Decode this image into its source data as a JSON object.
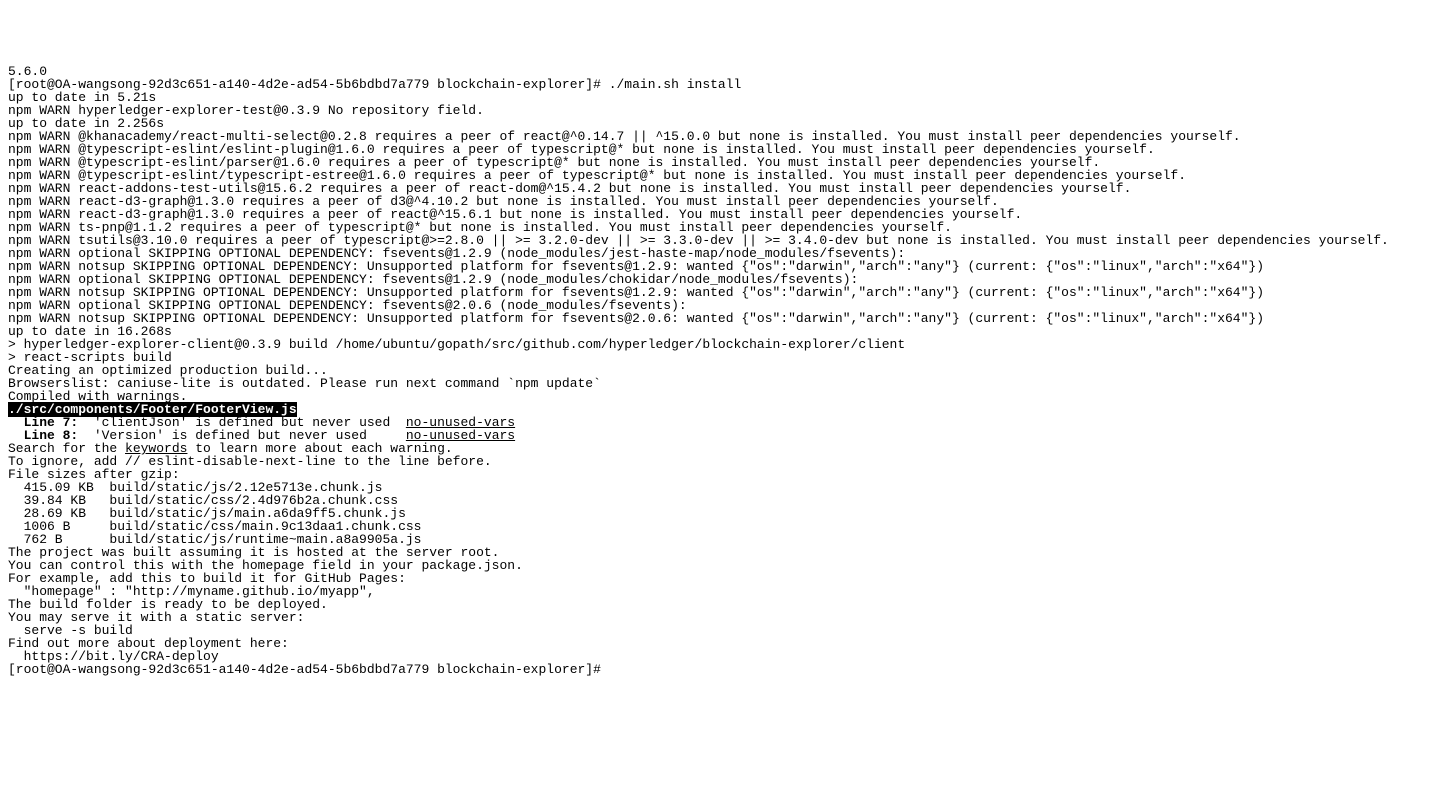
{
  "lines": [
    {
      "text": "5.6.0"
    },
    {
      "text": "[root@OA-wangsong-92d3c651-a140-4d2e-ad54-5b6bdbd7a779 blockchain-explorer]# ./main.sh install"
    },
    {
      "text": "up to date in 5.21s"
    },
    {
      "text": "npm WARN hyperledger-explorer-test@0.3.9 No repository field."
    },
    {
      "text": ""
    },
    {
      "text": "up to date in 2.256s"
    },
    {
      "text": "npm WARN @khanacademy/react-multi-select@0.2.8 requires a peer of react@^0.14.7 || ^15.0.0 but none is installed. You must install peer dependencies yourself."
    },
    {
      "text": "npm WARN @typescript-eslint/eslint-plugin@1.6.0 requires a peer of typescript@* but none is installed. You must install peer dependencies yourself."
    },
    {
      "text": "npm WARN @typescript-eslint/parser@1.6.0 requires a peer of typescript@* but none is installed. You must install peer dependencies yourself."
    },
    {
      "text": "npm WARN @typescript-eslint/typescript-estree@1.6.0 requires a peer of typescript@* but none is installed. You must install peer dependencies yourself."
    },
    {
      "text": "npm WARN react-addons-test-utils@15.6.2 requires a peer of react-dom@^15.4.2 but none is installed. You must install peer dependencies yourself."
    },
    {
      "text": "npm WARN react-d3-graph@1.3.0 requires a peer of d3@^4.10.2 but none is installed. You must install peer dependencies yourself."
    },
    {
      "text": "npm WARN react-d3-graph@1.3.0 requires a peer of react@^15.6.1 but none is installed. You must install peer dependencies yourself."
    },
    {
      "text": "npm WARN ts-pnp@1.1.2 requires a peer of typescript@* but none is installed. You must install peer dependencies yourself."
    },
    {
      "text": "npm WARN tsutils@3.10.0 requires a peer of typescript@>=2.8.0 || >= 3.2.0-dev || >= 3.3.0-dev || >= 3.4.0-dev but none is installed. You must install peer dependencies yourself."
    },
    {
      "text": "npm WARN optional SKIPPING OPTIONAL DEPENDENCY: fsevents@1.2.9 (node_modules/jest-haste-map/node_modules/fsevents):"
    },
    {
      "text": "npm WARN notsup SKIPPING OPTIONAL DEPENDENCY: Unsupported platform for fsevents@1.2.9: wanted {\"os\":\"darwin\",\"arch\":\"any\"} (current: {\"os\":\"linux\",\"arch\":\"x64\"})"
    },
    {
      "text": "npm WARN optional SKIPPING OPTIONAL DEPENDENCY: fsevents@1.2.9 (node_modules/chokidar/node_modules/fsevents):"
    },
    {
      "text": "npm WARN notsup SKIPPING OPTIONAL DEPENDENCY: Unsupported platform for fsevents@1.2.9: wanted {\"os\":\"darwin\",\"arch\":\"any\"} (current: {\"os\":\"linux\",\"arch\":\"x64\"})"
    },
    {
      "text": "npm WARN optional SKIPPING OPTIONAL DEPENDENCY: fsevents@2.0.6 (node_modules/fsevents):"
    },
    {
      "text": "npm WARN notsup SKIPPING OPTIONAL DEPENDENCY: Unsupported platform for fsevents@2.0.6: wanted {\"os\":\"darwin\",\"arch\":\"any\"} (current: {\"os\":\"linux\",\"arch\":\"x64\"})"
    },
    {
      "text": ""
    },
    {
      "text": "up to date in 16.268s"
    },
    {
      "text": ""
    },
    {
      "text": "> hyperledger-explorer-client@0.3.9 build /home/ubuntu/gopath/src/github.com/hyperledger/blockchain-explorer/client"
    },
    {
      "text": "> react-scripts build"
    },
    {
      "text": ""
    },
    {
      "text": "Creating an optimized production build..."
    },
    {
      "text": "Browserslist: caniuse-lite is outdated. Please run next command `npm update`"
    },
    {
      "text": "Compiled with warnings."
    },
    {
      "text": ""
    }
  ],
  "filePath": "./src/components/Footer/FooterView.js",
  "warn1": {
    "prefix": "  Line 7:",
    "mid": "  'clientJson' is defined but never used  ",
    "rule": "no-unused-vars"
  },
  "warn2": {
    "prefix": "  Line 8:",
    "mid": "  'Version' is defined but never used     ",
    "rule": "no-unused-vars"
  },
  "searchLine": {
    "pre": "Search for the ",
    "kw": "keywords",
    "post": " to learn more about each warning."
  },
  "ignoreLine": "To ignore, add // eslint-disable-next-line to the line before.",
  "blank": "",
  "fsHeader": "File sizes after gzip:",
  "fileSizes": [
    "  415.09 KB  build/static/js/2.12e5713e.chunk.js",
    "  39.84 KB   build/static/css/2.4d976b2a.chunk.css",
    "  28.69 KB   build/static/js/main.a6da9ff5.chunk.js",
    "  1006 B     build/static/css/main.9c13daa1.chunk.css",
    "  762 B      build/static/js/runtime~main.a8a9905a.js"
  ],
  "tail": [
    "",
    "The project was built assuming it is hosted at the server root.",
    "You can control this with the homepage field in your package.json.",
    "For example, add this to build it for GitHub Pages:",
    "",
    "  \"homepage\" : \"http://myname.github.io/myapp\",",
    "",
    "The build folder is ready to be deployed.",
    "You may serve it with a static server:",
    "",
    "  serve -s build",
    "",
    "Find out more about deployment here:",
    "",
    "  https://bit.ly/CRA-deploy",
    "",
    "[root@OA-wangsong-92d3c651-a140-4d2e-ad54-5b6bdbd7a779 blockchain-explorer]#"
  ]
}
